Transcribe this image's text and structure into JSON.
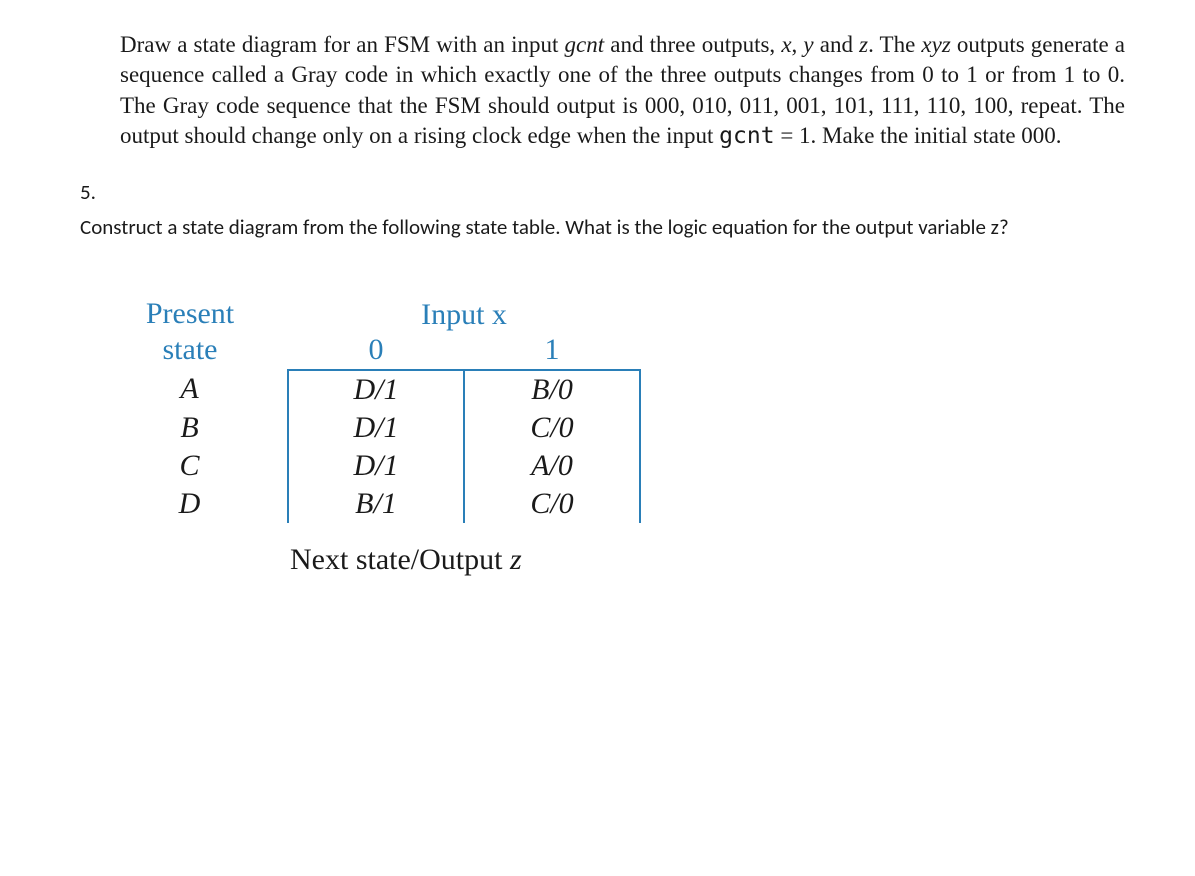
{
  "problem4": {
    "text": "Draw a state diagram for an FSM with an input gcnt and three outputs, x, y and z. The xyz outputs generate a sequence called a Gray code in which exactly one of the three outputs changes from 0 to 1 or from 1 to 0. The Gray code sequence that the FSM should output is 000, 010, 011, 001, 101, 111, 110, 100, repeat. The output should change only on a rising clock edge when the input gcnt = 1. Make the initial state 000."
  },
  "problem5": {
    "number": "5.",
    "text": "Construct a state diagram from the following state table. What is the logic equation for the output variable z?"
  },
  "table": {
    "headers": {
      "present_state": "Present state",
      "input": "Input x",
      "col0": "0",
      "col1": "1"
    },
    "rows": [
      {
        "state": "A",
        "x0": "D/1",
        "x1": "B/0"
      },
      {
        "state": "B",
        "x0": "D/1",
        "x1": "C/0"
      },
      {
        "state": "C",
        "x0": "D/1",
        "x1": "A/0"
      },
      {
        "state": "D",
        "x0": "B/1",
        "x1": "C/0"
      }
    ],
    "footer": "Next state/Output z"
  }
}
